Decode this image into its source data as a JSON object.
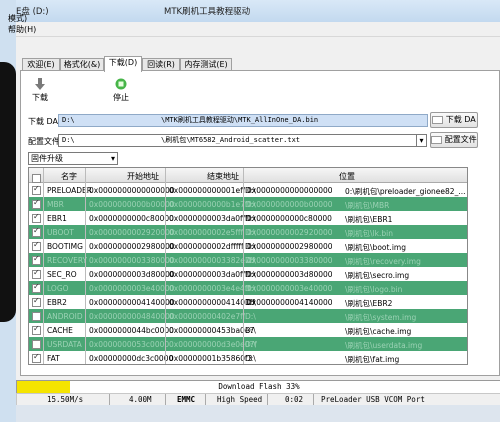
{
  "window": {
    "title_left": "E盘 (D:)",
    "title_center": "MTK刷机工具教程驱动",
    "app_title_fragment": "模式)",
    "menu_help": "帮助(H)"
  },
  "tabs": [
    {
      "label": "欢迎(E)"
    },
    {
      "label": "格式化(&)"
    },
    {
      "label": "下载(D)"
    },
    {
      "label": "回读(R)"
    },
    {
      "label": "内存测试(E)"
    }
  ],
  "toolbar": {
    "download_label": "下载",
    "stop_label": "停止"
  },
  "download_agent": {
    "label": "下载 DA",
    "value_prefix": "D:\\",
    "value": "\\MTK刷机工具教程驱动\\MTK_AllInOne_DA.bin",
    "button": "下载 DA"
  },
  "scatter": {
    "label": "配置文件",
    "value_prefix": "D:\\",
    "value": "\\刷机包\\MT6582_Android_scatter.txt",
    "button": "配置文件"
  },
  "mode_select": {
    "selected": "固件升级"
  },
  "table": {
    "headers": [
      "名字",
      "开始地址",
      "结束地址",
      "位置"
    ],
    "rows": [
      {
        "checked": true,
        "enabled": true,
        "name": "PRELOADER",
        "start": "0x0000000000000000",
        "end": "0x000000000001eff",
        "region": "0x0000000000000000",
        "location": "0:\\刷机包\\preloader_gionee82_..."
      },
      {
        "checked": true,
        "enabled": false,
        "name": "MBR",
        "start": "0x0000000000b00000",
        "end": "0x0000000000b1e7f",
        "region": "0x0000000000b00000",
        "location": "\\刷机包\\MBR"
      },
      {
        "checked": true,
        "enabled": true,
        "name": "EBR1",
        "start": "0x0000000000c80000",
        "end": "0x0000000003da0fff",
        "region": "0x0000000000c80000",
        "location": "\\刷机包\\EBR1"
      },
      {
        "checked": true,
        "enabled": false,
        "name": "UBOOT",
        "start": "0x0000000002920000",
        "end": "0x0000000002e5fff",
        "region": "0x0000000002920000",
        "location": "\\刷机包\\lk.bin"
      },
      {
        "checked": true,
        "enabled": true,
        "name": "BOOTIMG",
        "start": "0x0000000002980000",
        "end": "0x0000000002dfffff",
        "region": "0x0000000002980000",
        "location": "\\刷机包\\boot.img"
      },
      {
        "checked": true,
        "enabled": false,
        "name": "RECOVERY",
        "start": "0x0000000003380000",
        "end": "0x0000000003382e7ff",
        "region": "0x0000000003380000",
        "location": "\\刷机包\\recovery.img"
      },
      {
        "checked": true,
        "enabled": true,
        "name": "SEC_RO",
        "start": "0x0000000003d80000",
        "end": "0x0000000003da0fff",
        "region": "0x0000000003d80000",
        "location": "\\刷机包\\secro.img"
      },
      {
        "checked": true,
        "enabled": false,
        "name": "LOGO",
        "start": "0x0000000003e40000",
        "end": "0x0000000003e4e4ff",
        "region": "0x0000000003e40000",
        "location": "\\刷机包\\logo.bin"
      },
      {
        "checked": true,
        "enabled": true,
        "name": "EBR2",
        "start": "0x0000000004140000",
        "end": "0x000000000041401ff",
        "region": "0x0000000004140000",
        "location": "\\刷机包\\EBR2"
      },
      {
        "checked": false,
        "enabled": false,
        "name": "ANDROID",
        "start": "0x0000000004840000",
        "end": "0x00000000402e7ff",
        "region": "",
        "location": "\\刷机包\\system.img"
      },
      {
        "checked": true,
        "enabled": true,
        "name": "CACHE",
        "start": "0x0000000044bc0000",
        "end": "0x00000000453ba0e7",
        "region": "",
        "location": "\\刷机包\\cache.img"
      },
      {
        "checked": false,
        "enabled": false,
        "name": "USRDATA",
        "start": "0x0000000053c0000",
        "end": "0x000000000d3e0e07f",
        "region": "",
        "location": "\\刷机包\\userdata.img"
      },
      {
        "checked": true,
        "enabled": true,
        "name": "FAT",
        "start": "0x00000000dc3c0000",
        "end": "0x00000001b35860f3",
        "region": "",
        "location": "\\刷机包\\fat.img"
      }
    ]
  },
  "progress": {
    "percent": 33,
    "text": "Download Flash 33%",
    "color": "#f5e400"
  },
  "status": {
    "speed": "15.50M/s",
    "size": "4.00M",
    "storage": "EMMC",
    "usb_speed": "High Speed",
    "time": "0:02",
    "port": "PreLoader USB VCOM Port"
  },
  "colors": {
    "disabled_row": "#4aa675",
    "accent_field": "#cfe0f5"
  }
}
